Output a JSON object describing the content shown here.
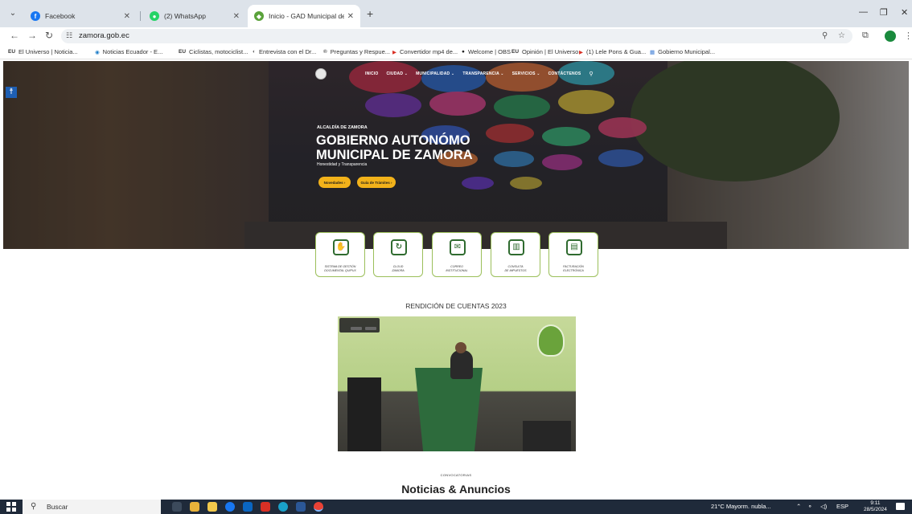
{
  "browser": {
    "tabs": [
      {
        "label": "Facebook",
        "active": false
      },
      {
        "label": "(2) WhatsApp",
        "active": false
      },
      {
        "label": "Inicio - GAD Municipal de Zam",
        "active": true
      }
    ],
    "new_tab": "+",
    "url": "zamora.gob.ec",
    "bookmarks": [
      {
        "icon": "EU",
        "label": "El Universo | Noticia..."
      },
      {
        "icon": "◉",
        "label": "Noticias Ecuador - E..."
      },
      {
        "icon": "EU",
        "label": "Ciclistas, motociclist..."
      },
      {
        "icon": "◐",
        "label": "Entrevista con el Dr..."
      },
      {
        "icon": "®",
        "label": "Preguntas y Respue..."
      },
      {
        "icon": "▶",
        "label": "Convertidor mp4 de..."
      },
      {
        "icon": "●",
        "label": "Welcome | OBS"
      },
      {
        "icon": "EU",
        "label": "Opinión | El Universo"
      },
      {
        "icon": "▶",
        "label": "(1) Lele Pons & Gua..."
      },
      {
        "icon": "▦",
        "label": "Gobierno Municipal..."
      }
    ]
  },
  "site": {
    "nav": [
      "INICIO",
      "CIUDAD ⌄",
      "MUNICIPALIDAD ⌄",
      "TRANSPARENCIA ⌄",
      "SERVICIOS ⌄",
      "CONTÁCTENOS"
    ],
    "hero": {
      "kicker": "ALCALDÍA DE ZAMORA",
      "title_line1": "GOBIERNO AUTONÓMO",
      "title_line2": "MUNICIPAL DE ZAMORA",
      "subtitle": "Honestidad y Transparencia",
      "btn1": "Novedades  ›",
      "btn2": "Guía de Trámites  ›"
    },
    "services": [
      {
        "icon": "handshake-icon",
        "label_line1": "SISTEMA DE GESTIÓN",
        "label_line2": "DOCUMENTAL QUIPUX"
      },
      {
        "icon": "refresh-icon",
        "label_line1": "CLOUD",
        "label_line2": "ZAMORA"
      },
      {
        "icon": "mail-icon",
        "label_line1": "CORREO",
        "label_line2": "INSTITUCIONAL"
      },
      {
        "icon": "chart-icon",
        "label_line1": "CONSULTA",
        "label_line2": "DE IMPUESTOS"
      },
      {
        "icon": "document-icon",
        "label_line1": "FACTURACIÓN",
        "label_line2": "ELECTRÓNICA"
      }
    ],
    "rendicion_title": "RENDICIÓN DE CUENTAS 2023",
    "convocatorias": "CONVOCATORIAS",
    "noticias_title": "Noticias & Anuncios"
  },
  "taskbar": {
    "search_placeholder": "Buscar",
    "weather": "21°C  Mayorm. nubla...",
    "lang": "ESP",
    "time": "9:11",
    "date": "28/5/2024"
  },
  "colors": {
    "accent_yellow": "#f2b21a",
    "card_border": "#9bbf5a",
    "icon_green": "#2f6b2f",
    "taskbar": "#1f2a3a"
  }
}
